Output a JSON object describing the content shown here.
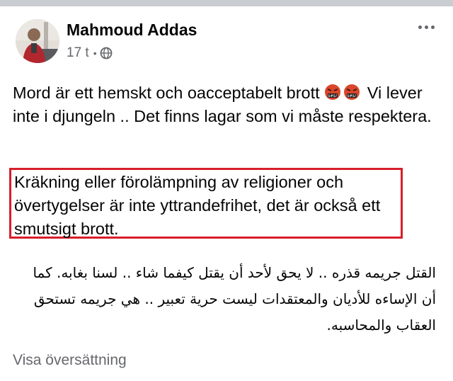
{
  "post": {
    "author": "Mahmoud Addas",
    "timestamp": "17 t",
    "separator": "•",
    "audience_icon": "globe-icon",
    "menu_icon": "more-options-icon",
    "paragraph_1_part_1": "Mord är ett hemskt och oacceptabelt brott",
    "emoji": "face-with-symbols-on-mouth",
    "paragraph_1_part_2": " Vi lever inte i djungeln .. Det finns lagar som vi måste respektera.",
    "paragraph_2": "Kräkning eller förolämpning av religioner och övertygelser är inte yttrandefrihet, det är också ett smutsigt brott.",
    "arabic_text": "القتل جريمه قذره .. لا يحق لأحد أن يقتل كيفما شاء .. لسنا بغابه. كما أن الإساءه للأديان والمعتقدات ليست حرية تعبير .. هي جريمه تستحق العقاب والمحاسبه.",
    "see_translation": "Visa översättning"
  },
  "colors": {
    "highlight_border": "#d71f2a",
    "secondary_text": "#65676b",
    "top_bar": "#c9ccd1"
  }
}
